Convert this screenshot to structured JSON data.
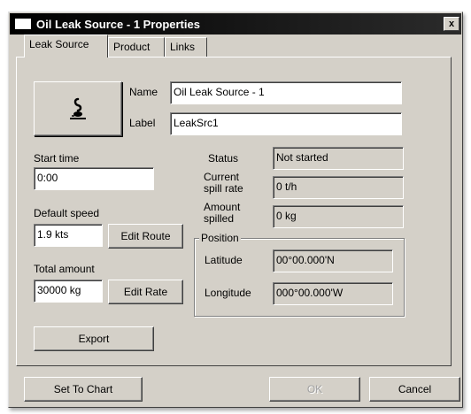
{
  "window": {
    "title": "Oil Leak Source - 1 Properties",
    "close_glyph": "x"
  },
  "tabs": [
    {
      "label": "Leak Source",
      "active": true
    },
    {
      "label": "Product",
      "active": false
    },
    {
      "label": "Links",
      "active": false
    }
  ],
  "source_icon": "oil-leak-icon",
  "name": {
    "label": "Name",
    "value": "Oil Leak Source - 1"
  },
  "label_field": {
    "label": "Label",
    "value": "LeakSrc1"
  },
  "start_time": {
    "label": "Start time",
    "value": "0:00"
  },
  "default_speed": {
    "label": "Default speed",
    "value": "1.9 kts",
    "button": "Edit Route"
  },
  "total_amount": {
    "label": "Total amount",
    "value": "30000 kg",
    "button": "Edit Rate"
  },
  "status": {
    "label": "Status",
    "value": "Not started"
  },
  "spill_rate": {
    "label_line1": "Current",
    "label_line2": "spill rate",
    "value": "0 t/h"
  },
  "amount_spilled": {
    "label_line1": "Amount",
    "label_line2": "spilled",
    "value": "0 kg"
  },
  "position": {
    "title": "Position",
    "latitude_label": "Latitude",
    "latitude_value": "00°00.000'N",
    "longitude_label": "Longitude",
    "longitude_value": "000°00.000'W"
  },
  "buttons": {
    "export": "Export",
    "set_to_chart": "Set To Chart",
    "ok": "OK",
    "cancel": "Cancel"
  }
}
